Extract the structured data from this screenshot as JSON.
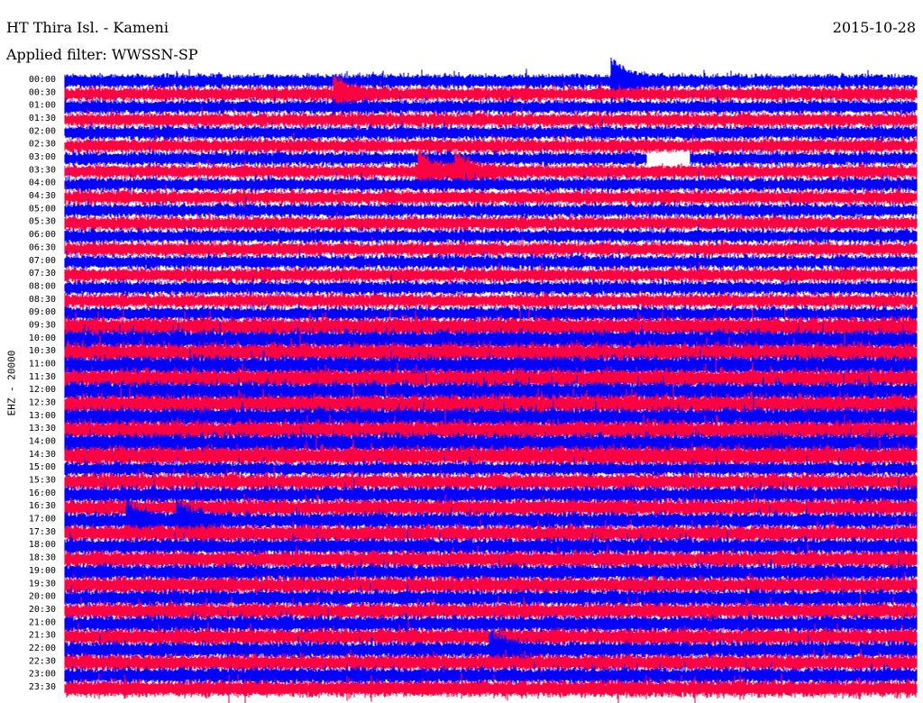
{
  "header": {
    "title": "HT Thira Isl. - Kameni",
    "date": "2015-10-28",
    "filter": "Applied filter: WWSSN-SP"
  },
  "chart_data": {
    "type": "line",
    "subtype": "helicorder",
    "title": "HT Thira Isl. - Kameni",
    "date": "2015-10-28",
    "filter": "WWSSN-SP",
    "ylabel": "EHZ - 20000",
    "row_duration_minutes": 30,
    "row_labels": [
      "00:00",
      "00:30",
      "01:00",
      "01:30",
      "02:00",
      "02:30",
      "03:00",
      "03:30",
      "04:00",
      "04:30",
      "05:00",
      "05:30",
      "06:00",
      "06:30",
      "07:00",
      "07:30",
      "08:00",
      "08:30",
      "09:00",
      "09:30",
      "10:00",
      "10:30",
      "11:00",
      "11:30",
      "12:00",
      "12:30",
      "13:00",
      "13:30",
      "14:00",
      "14:30",
      "15:00",
      "15:30",
      "16:00",
      "16:30",
      "17:00",
      "17:30",
      "18:00",
      "18:30",
      "19:00",
      "19:30",
      "20:00",
      "20:30",
      "21:00",
      "21:30",
      "22:00",
      "22:30",
      "23:00",
      "23:30"
    ],
    "trace_colors": [
      "#0000ff",
      "#ff0040"
    ],
    "events": [
      {
        "row": "00:30",
        "minute": 9.5
      },
      {
        "row": "00:00",
        "minute": 19.3
      },
      {
        "row": "03:30",
        "minute": 12.5
      },
      {
        "row": "03:30",
        "minute": 13.8
      },
      {
        "row": "17:00",
        "minute": 2.2
      },
      {
        "row": "17:00",
        "minute": 4.0
      },
      {
        "row": "22:00",
        "minute": 15.0
      }
    ],
    "gaps": [
      {
        "row": "03:00",
        "start_minute": 20.5,
        "end_minute": 22.0
      }
    ]
  }
}
